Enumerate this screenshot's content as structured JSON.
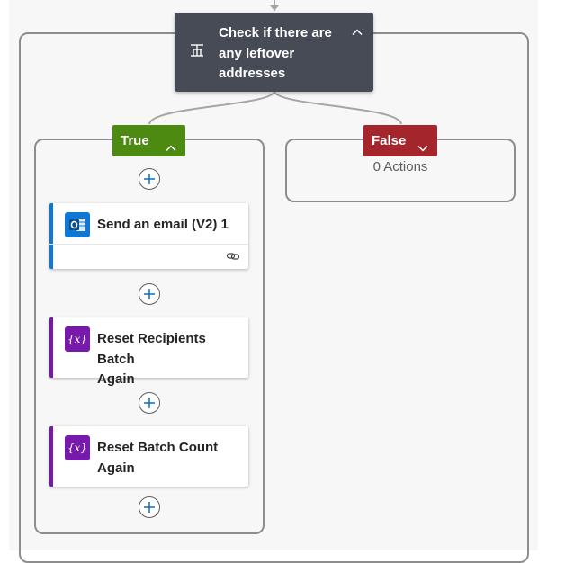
{
  "condition": {
    "title": "Check if there are\nany leftover\naddresses",
    "icon": "condition-icon",
    "collapse_icon": "chevron-up-icon",
    "background": "#464b55"
  },
  "true_branch": {
    "label": "True",
    "color": "#4c8a12",
    "chevron": "chevron-up-icon",
    "actions": [
      {
        "title": "Send an email (V2) 1",
        "icon": "outlook-icon",
        "accent": "#0f78d4",
        "footer_icon": "link-icon"
      },
      {
        "title": "Reset Recipients Batch\nAgain",
        "icon": "variable-icon",
        "icon_text": "{x}",
        "accent": "#7719aa"
      },
      {
        "title": "Reset Batch Count\nAgain",
        "icon": "variable-icon",
        "icon_text": "{x}",
        "accent": "#7719aa"
      }
    ]
  },
  "false_branch": {
    "label": "False",
    "color": "#a4262c",
    "chevron": "chevron-down-icon",
    "empty_text": "0 Actions"
  },
  "add_button_icon": "plus-icon",
  "connector_color": "#a5a5a5"
}
